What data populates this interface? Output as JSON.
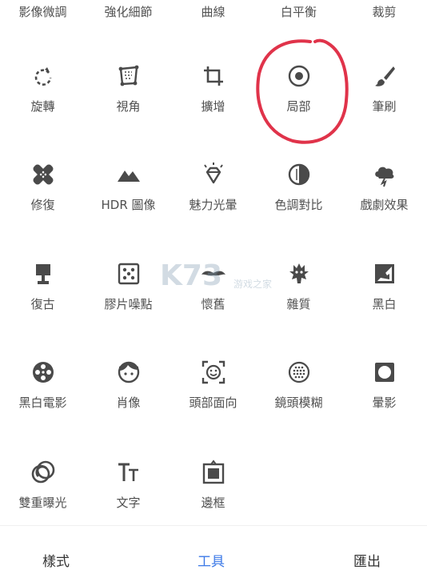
{
  "top_row": [
    "影像微調",
    "強化細節",
    "曲線",
    "白平衡",
    "裁剪"
  ],
  "tools": [
    {
      "label": "旋轉",
      "icon": "rotate-icon"
    },
    {
      "label": "視角",
      "icon": "perspective-icon"
    },
    {
      "label": "擴增",
      "icon": "expand-icon"
    },
    {
      "label": "局部",
      "icon": "selective-icon"
    },
    {
      "label": "筆刷",
      "icon": "brush-icon"
    },
    {
      "label": "修復",
      "icon": "healing-icon"
    },
    {
      "label": "HDR 圖像",
      "icon": "hdr-icon"
    },
    {
      "label": "魅力光暈",
      "icon": "glamour-glow-icon"
    },
    {
      "label": "色調對比",
      "icon": "tonal-contrast-icon"
    },
    {
      "label": "戲劇效果",
      "icon": "drama-icon"
    },
    {
      "label": "復古",
      "icon": "vintage-icon"
    },
    {
      "label": "膠片噪點",
      "icon": "grainy-film-icon"
    },
    {
      "label": "懷舊",
      "icon": "retrolux-icon"
    },
    {
      "label": "雜質",
      "icon": "grunge-icon"
    },
    {
      "label": "黑白",
      "icon": "black-white-icon"
    },
    {
      "label": "黑白電影",
      "icon": "noir-icon"
    },
    {
      "label": "肖像",
      "icon": "portrait-icon"
    },
    {
      "label": "頭部面向",
      "icon": "head-pose-icon"
    },
    {
      "label": "鏡頭模糊",
      "icon": "lens-blur-icon"
    },
    {
      "label": "暈影",
      "icon": "vignette-icon"
    },
    {
      "label": "雙重曝光",
      "icon": "double-exposure-icon"
    },
    {
      "label": "文字",
      "icon": "text-icon"
    },
    {
      "label": "邊框",
      "icon": "frames-icon"
    }
  ],
  "tabs": [
    {
      "label": "樣式",
      "active": false
    },
    {
      "label": "工具",
      "active": true
    },
    {
      "label": "匯出",
      "active": false
    }
  ],
  "watermark": {
    "brand": "K73",
    "site": "游戏之家"
  },
  "colors": {
    "icon": "#4a4a4a",
    "active_tab": "#3b78e7",
    "annotation": "#e0334a"
  }
}
